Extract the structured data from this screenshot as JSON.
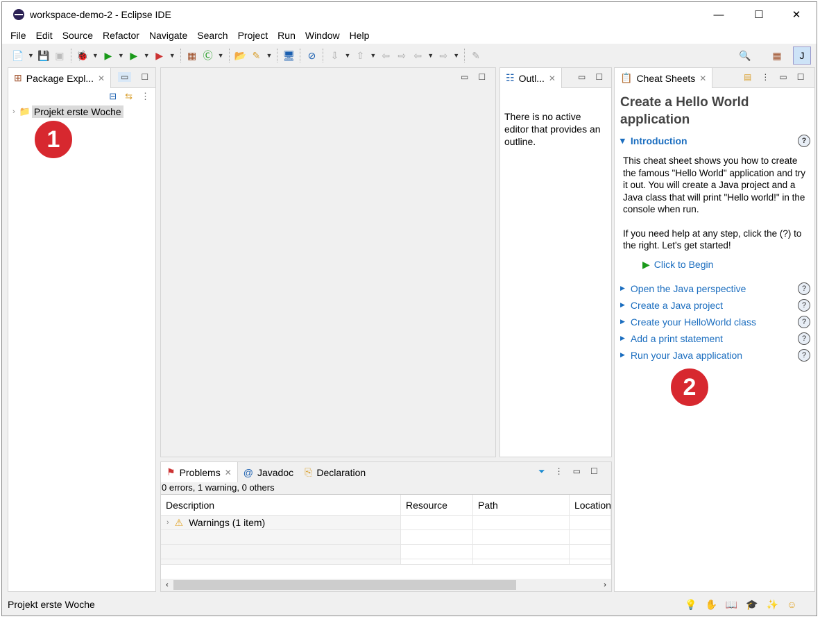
{
  "window": {
    "title": "workspace-demo-2 - Eclipse IDE",
    "minimize": "—",
    "maximize": "☐",
    "close": "✕"
  },
  "menu": [
    "File",
    "Edit",
    "Source",
    "Refactor",
    "Navigate",
    "Search",
    "Project",
    "Run",
    "Window",
    "Help"
  ],
  "package_explorer": {
    "tab": "Package Expl...",
    "project": "Projekt erste Woche"
  },
  "outline": {
    "tab": "Outl...",
    "message": "There is no active editor that provides an outline."
  },
  "cheat_sheet": {
    "tab": "Cheat Sheets",
    "title": "Create a Hello World application",
    "intro_heading": "Introduction",
    "intro_text": "This cheat sheet shows you how to create the famous \"Hello World\" application and try it out. You will create a Java project and a Java class that will print \"Hello world!\" in the console when run.",
    "intro_text2": "If you need help at any step, click the (?) to the right. Let's get started!",
    "begin": "Click to Begin",
    "steps": [
      "Open the Java perspective",
      "Create a Java project",
      "Create your HelloWorld class",
      "Add a print statement",
      "Run your Java application"
    ],
    "help_glyph": "?"
  },
  "problems": {
    "tabs": [
      "Problems",
      "Javadoc",
      "Declaration"
    ],
    "summary": "0 errors, 1 warning, 0 others",
    "columns": [
      "Description",
      "Resource",
      "Path",
      "Location"
    ],
    "rows": [
      {
        "description": "Warnings (1 item)"
      }
    ]
  },
  "status": {
    "text": "Projekt erste Woche"
  },
  "annotations": [
    "1",
    "2"
  ],
  "colors": {
    "link": "#1a6dbf",
    "badge": "#d7282f",
    "selection": "#dadada"
  }
}
